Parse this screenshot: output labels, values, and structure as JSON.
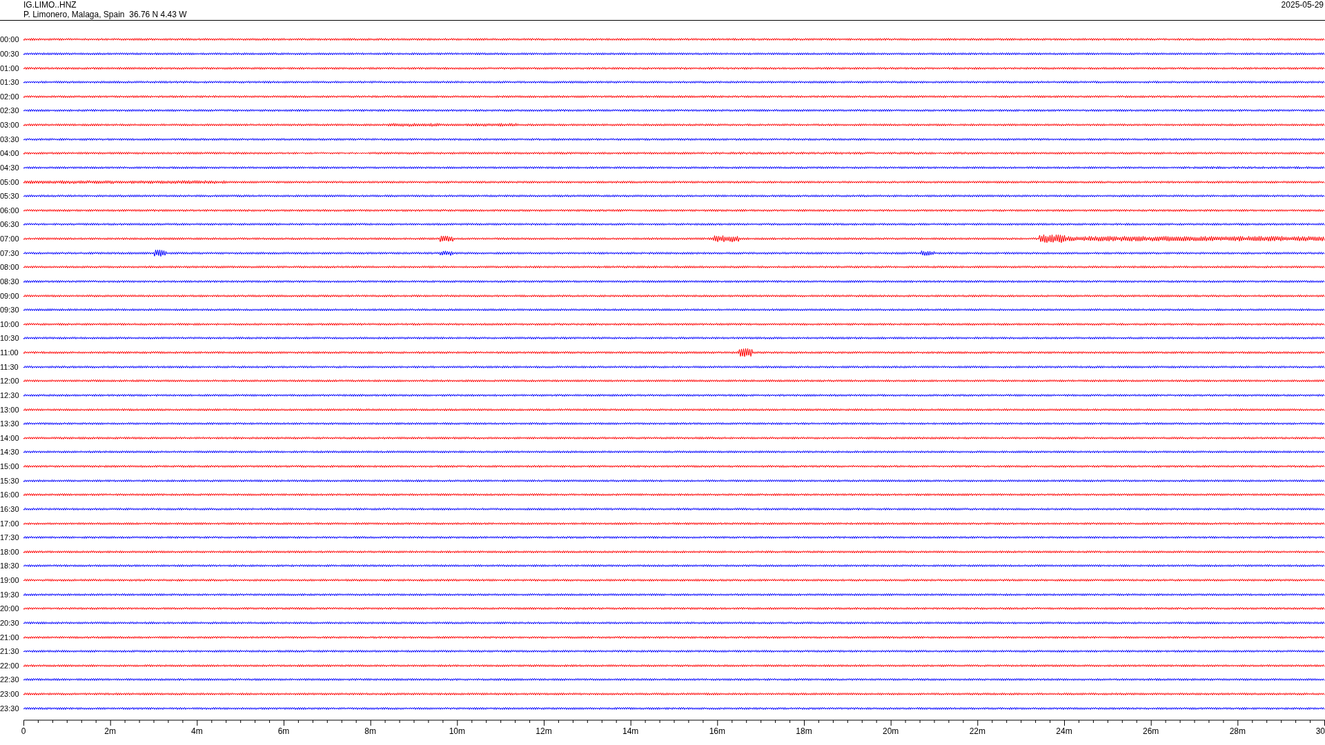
{
  "header": {
    "station": "IG.LIMO..HNZ",
    "location": "P. Limonero, Malaga, Spain  36.76 N 4.43 W",
    "date": "2025-05-29"
  },
  "traces": [
    {
      "time": "00:00",
      "color": "#ff0000"
    },
    {
      "time": "00:30",
      "color": "#0000ff"
    },
    {
      "time": "01:00",
      "color": "#ff0000"
    },
    {
      "time": "01:30",
      "color": "#0000ff"
    },
    {
      "time": "02:00",
      "color": "#ff0000"
    },
    {
      "time": "02:30",
      "color": "#0000ff"
    },
    {
      "time": "03:00",
      "color": "#ff0000"
    },
    {
      "time": "03:30",
      "color": "#0000ff"
    },
    {
      "time": "04:00",
      "color": "#ff0000"
    },
    {
      "time": "04:30",
      "color": "#0000ff"
    },
    {
      "time": "05:00",
      "color": "#ff0000"
    },
    {
      "time": "05:30",
      "color": "#0000ff"
    },
    {
      "time": "06:00",
      "color": "#ff0000"
    },
    {
      "time": "06:30",
      "color": "#0000ff"
    },
    {
      "time": "07:00",
      "color": "#ff0000"
    },
    {
      "time": "07:30",
      "color": "#0000ff"
    },
    {
      "time": "08:00",
      "color": "#ff0000"
    },
    {
      "time": "08:30",
      "color": "#0000ff"
    },
    {
      "time": "09:00",
      "color": "#ff0000"
    },
    {
      "time": "09:30",
      "color": "#0000ff"
    },
    {
      "time": "10:00",
      "color": "#ff0000"
    },
    {
      "time": "10:30",
      "color": "#0000ff"
    },
    {
      "time": "11:00",
      "color": "#ff0000"
    },
    {
      "time": "11:30",
      "color": "#0000ff"
    },
    {
      "time": "12:00",
      "color": "#ff0000"
    },
    {
      "time": "12:30",
      "color": "#0000ff"
    },
    {
      "time": "13:00",
      "color": "#ff0000"
    },
    {
      "time": "13:30",
      "color": "#0000ff"
    },
    {
      "time": "14:00",
      "color": "#ff0000"
    },
    {
      "time": "14:30",
      "color": "#0000ff"
    },
    {
      "time": "15:00",
      "color": "#ff0000"
    },
    {
      "time": "15:30",
      "color": "#0000ff"
    },
    {
      "time": "16:00",
      "color": "#ff0000"
    },
    {
      "time": "16:30",
      "color": "#0000ff"
    },
    {
      "time": "17:00",
      "color": "#ff0000"
    },
    {
      "time": "17:30",
      "color": "#0000ff"
    },
    {
      "time": "18:00",
      "color": "#ff0000"
    },
    {
      "time": "18:30",
      "color": "#0000ff"
    },
    {
      "time": "19:00",
      "color": "#ff0000"
    },
    {
      "time": "19:30",
      "color": "#0000ff"
    },
    {
      "time": "20:00",
      "color": "#ff0000"
    },
    {
      "time": "20:30",
      "color": "#0000ff"
    },
    {
      "time": "21:00",
      "color": "#ff0000"
    },
    {
      "time": "21:30",
      "color": "#0000ff"
    },
    {
      "time": "22:00",
      "color": "#ff0000"
    },
    {
      "time": "22:30",
      "color": "#0000ff"
    },
    {
      "time": "23:00",
      "color": "#ff0000"
    },
    {
      "time": "23:30",
      "color": "#0000ff"
    }
  ],
  "time_axis": {
    "labels": [
      "0",
      "2m",
      "4m",
      "6m",
      "8m",
      "10m",
      "12m",
      "14m",
      "16m",
      "18m",
      "20m",
      "22m",
      "24m",
      "26m",
      "28m",
      "30"
    ]
  }
}
